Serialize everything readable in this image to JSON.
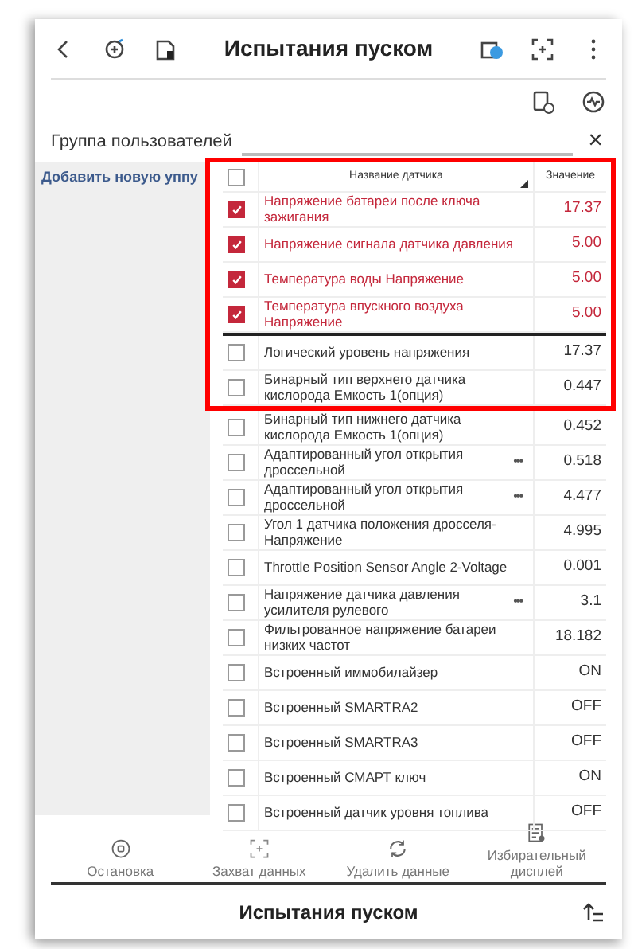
{
  "title_bar": {
    "title": "Испытания пуском"
  },
  "group": {
    "label": "Группа пользователей",
    "close": "×"
  },
  "sidebar": {
    "add_link": "Добавить новую уппу"
  },
  "table": {
    "all_checked": false,
    "columns": [
      {
        "label": "Название датчика",
        "sorted": true
      },
      {
        "label": "Значение",
        "sorted": false
      }
    ],
    "framed_rows": [
      {
        "name": "Напряжение батареи после ключа зажигания",
        "value": "17.37",
        "checked": true
      },
      {
        "name": "Напряжение сигнала датчика давления",
        "value": "5.00",
        "checked": true
      },
      {
        "name": "Температура воды Напряжение",
        "value": "5.00",
        "checked": true
      },
      {
        "name": "Температура впускного воздуха Напряжение",
        "value": "5.00",
        "checked": true
      },
      {
        "name": "Логический уровень напряжения",
        "value": "17.37",
        "checked": false
      },
      {
        "name": "Бинарный тип верхнего датчика кислорода Емкость 1(опция)",
        "value": "0.447",
        "checked": false
      }
    ],
    "rows": [
      {
        "name": "Бинарный тип нижнего датчика кислорода Емкость 1(опция)",
        "value": "0.452",
        "checked": false
      },
      {
        "name": "Адаптированный угол открытия дроссельной",
        "value": "0.518",
        "checked": false,
        "menu": "•••"
      },
      {
        "name": "Адаптированный угол открытия дроссельной",
        "value": "4.477",
        "checked": false,
        "menu": "•••"
      },
      {
        "name": "Угол 1 датчика положения дросселя-Напряжение",
        "value": "4.995",
        "checked": false
      },
      {
        "name": "Throttle Position Sensor Angle 2-Voltage",
        "value": "0.001",
        "checked": false
      },
      {
        "name": "Напряжение датчика давления усилителя рулевого",
        "value": "3.1",
        "checked": false,
        "menu": "•••"
      },
      {
        "name": "Фильтрованное напряжение батареи низких частот",
        "value": "18.182",
        "checked": false
      },
      {
        "name": "Встроенный иммобилайзер",
        "value": "ON",
        "checked": false
      },
      {
        "name": "Встроенный SMARTRA2",
        "value": "OFF",
        "checked": false
      },
      {
        "name": "Встроенный SMARTRA3",
        "value": "OFF",
        "checked": false
      },
      {
        "name": "Встроенный СМАРТ ключ",
        "value": "ON",
        "checked": false
      },
      {
        "name": "Встроенный датчик уровня топлива",
        "value": "OFF",
        "checked": false
      }
    ]
  },
  "toolbar": [
    {
      "kind": "stop",
      "label": "Остановка"
    },
    {
      "kind": "capture",
      "label": "Захват данных"
    },
    {
      "kind": "clear",
      "label": "Удалить данные"
    },
    {
      "kind": "display",
      "label": "Избирательный дисплей"
    }
  ],
  "footer": {
    "title": "Испытания пуском"
  }
}
